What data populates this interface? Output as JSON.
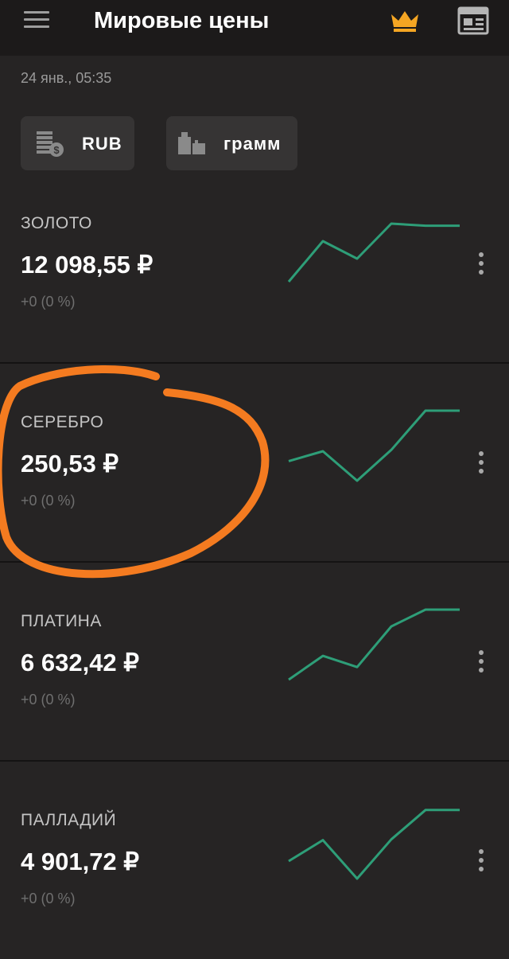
{
  "header": {
    "title": "Мировые цены",
    "menu_icon": "hamburger-menu-icon",
    "premium_icon": "crown-icon",
    "news_icon": "newspaper-icon",
    "premium_color": "#f5a623"
  },
  "timestamp": "24 янв., 05:35",
  "filters": {
    "currency": {
      "label": "RUB",
      "icon": "coins-icon"
    },
    "unit": {
      "label": "грамм",
      "icon": "weights-icon"
    }
  },
  "metals": [
    {
      "name": "ЗОЛОТО",
      "price": "12 098,55 ₽",
      "change": "+0 (0 %)",
      "trend": [
        0,
        58,
        33,
        83,
        80,
        80
      ]
    },
    {
      "name": "СЕРЕБРО",
      "price": "250,53 ₽",
      "change": "+0 (0 %)",
      "trend": [
        28,
        42,
        0,
        44,
        100,
        100
      ]
    },
    {
      "name": "ПЛАТИНА",
      "price": "6 632,42 ₽",
      "change": "+0 (0 %)",
      "trend": [
        0,
        34,
        18,
        76,
        100,
        100
      ]
    },
    {
      "name": "ПАЛЛАДИЙ",
      "price": "4 901,72 ₽",
      "change": "+0 (0 %)",
      "trend": [
        25,
        55,
        0,
        56,
        98,
        98
      ]
    }
  ],
  "colors": {
    "background": "#262424",
    "topbar": "#1c1a1a",
    "sparkline": "#2e9e78",
    "highlight": "#f47b20"
  }
}
